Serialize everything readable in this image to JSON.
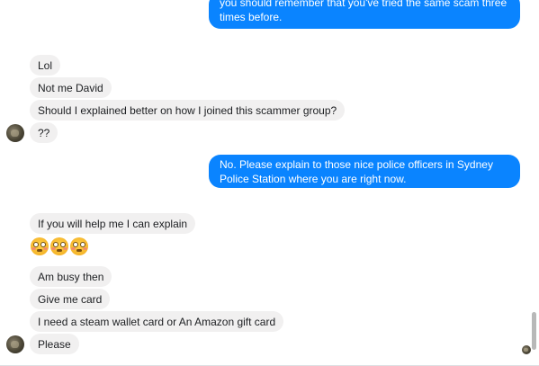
{
  "conversation": {
    "messages": [
      {
        "id": "m0",
        "side": "outgoing",
        "text": "you should remember that you've tried the same scam three times before."
      },
      {
        "id": "m1",
        "side": "incoming",
        "text": "Lol"
      },
      {
        "id": "m2",
        "side": "incoming",
        "text": "Not me David"
      },
      {
        "id": "m3",
        "side": "incoming",
        "text": "Should I explained better on how I joined this scammer group?"
      },
      {
        "id": "m4",
        "side": "incoming",
        "text": "??"
      },
      {
        "id": "m5",
        "side": "outgoing",
        "text": "No. Please explain to those nice police officers in Sydney Police Station where you are right now."
      },
      {
        "id": "m6",
        "side": "incoming",
        "text": "If you will help me I can explain"
      },
      {
        "id": "m7",
        "side": "incoming",
        "emoji": [
          "flushed-face",
          "flushed-face",
          "flushed-face"
        ]
      },
      {
        "id": "m8",
        "side": "incoming",
        "text": "Am busy then"
      },
      {
        "id": "m9",
        "side": "incoming",
        "text": "Give me card"
      },
      {
        "id": "m10",
        "side": "incoming",
        "text": "I need a steam wallet card or An Amazon gift card"
      },
      {
        "id": "m11",
        "side": "incoming",
        "text": "Please"
      }
    ]
  },
  "colors": {
    "outgoing_bubble": "#0a84ff",
    "incoming_bubble": "#f1f0f0",
    "incoming_text": "#1c1e21",
    "outgoing_text": "#ffffff"
  },
  "icons": {
    "avatar": "contact-avatar",
    "seen_indicator": "read-receipt-avatar",
    "emoji": "flushed-face"
  }
}
